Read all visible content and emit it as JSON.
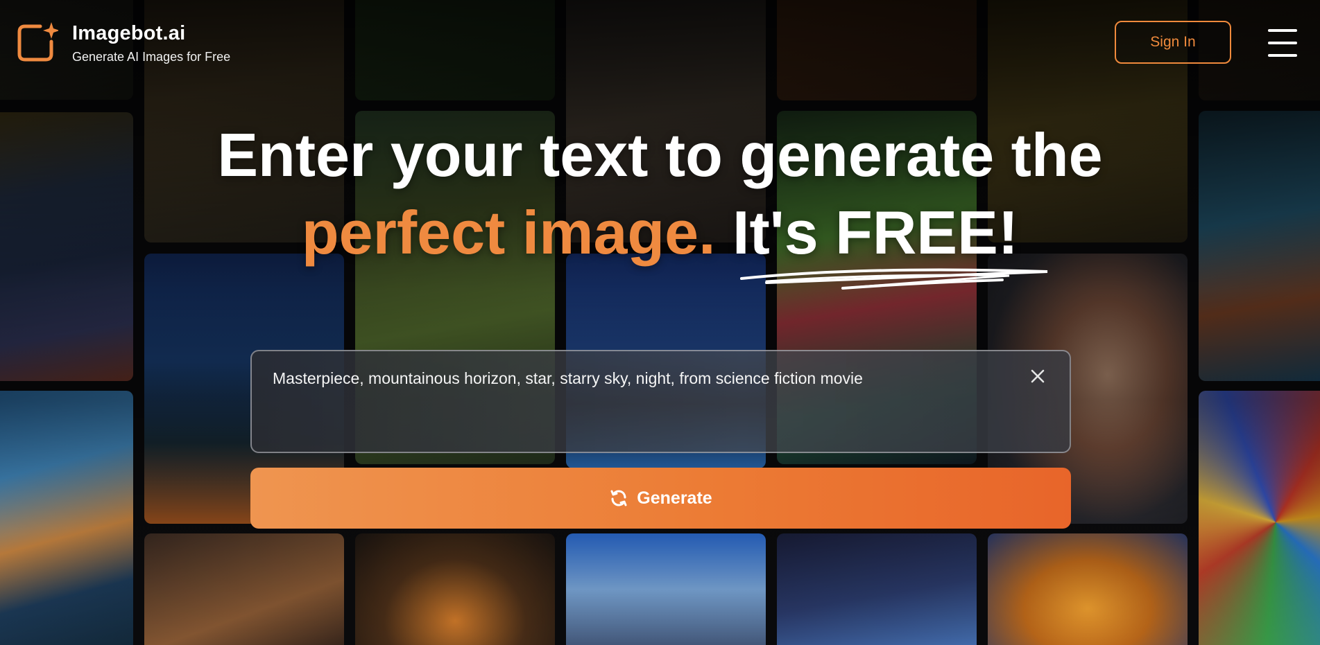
{
  "brand": {
    "name": "Imagebot.ai",
    "tagline": "Generate AI Images for Free",
    "accent_color": "#ef8a40"
  },
  "header": {
    "signin_label": "Sign In",
    "menu_icon": "hamburger-menu-icon"
  },
  "hero": {
    "line1": "Enter your text to generate the",
    "line2_highlight": "perfect image.",
    "line2_rest": " It's FREE!"
  },
  "prompt": {
    "value": "Masterpiece, mountainous horizon, star, starry sky, night, from science fiction movie",
    "clear_icon": "close-icon"
  },
  "generate": {
    "label": "Generate",
    "icon": "refresh-icon"
  }
}
